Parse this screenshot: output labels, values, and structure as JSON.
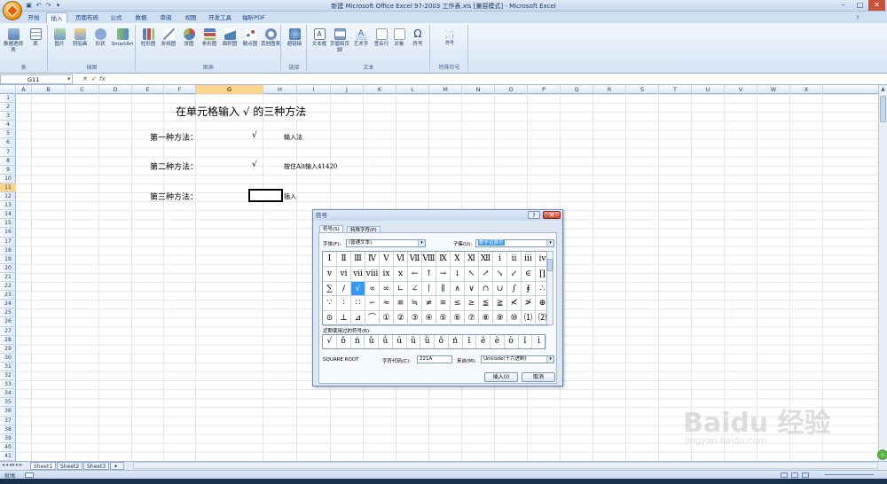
{
  "window": {
    "title": "新建 Microsoft Office Excel 97-2003 工作表.xls [兼容模式] - Microsoft Excel",
    "minimize": "–",
    "maximize": "□",
    "close": "✕"
  },
  "ribbon_tabs": [
    "开始",
    "插入",
    "页面布局",
    "公式",
    "数据",
    "审阅",
    "视图",
    "开发工具",
    "福昕PDF"
  ],
  "active_tab": "插入",
  "ribbon": {
    "groups": [
      {
        "label": "表",
        "buttons": [
          "数据透视表",
          "表"
        ]
      },
      {
        "label": "插图",
        "buttons": [
          "图片",
          "剪贴画",
          "形状",
          "SmartArt"
        ]
      },
      {
        "label": "图表",
        "buttons": [
          "柱形图",
          "折线图",
          "饼图",
          "条形图",
          "面积图",
          "散点图",
          "其他图表"
        ]
      },
      {
        "label": "链接",
        "buttons": [
          "超链接"
        ]
      },
      {
        "label": "文本",
        "buttons": [
          "文本框",
          "页眉和页脚",
          "艺术字",
          "签名行",
          "对象",
          "符号"
        ]
      },
      {
        "label": "特殊符号",
        "buttons": [
          "符号"
        ]
      }
    ]
  },
  "name_box": "G11",
  "formula_icons": [
    "✕",
    "✓",
    "fx"
  ],
  "columns": [
    "A",
    "B",
    "C",
    "D",
    "E",
    "F",
    "G",
    "H",
    "I",
    "J",
    "K",
    "L",
    "M",
    "N",
    "O",
    "P",
    "Q",
    "R",
    "S",
    "T",
    "U",
    "V",
    "W",
    "X"
  ],
  "selected_column": "G",
  "rows": [
    "1",
    "2",
    "3",
    "4",
    "5",
    "6",
    "7",
    "8",
    "9",
    "10",
    "11",
    "12",
    "13",
    "14",
    "15",
    "16",
    "17",
    "18",
    "19",
    "20",
    "21",
    "22",
    "23",
    "24",
    "25",
    "26",
    "27",
    "28",
    "29",
    "30",
    "31",
    "32",
    "33",
    "34",
    "35",
    "36",
    "37",
    "38",
    "39",
    "40",
    "41"
  ],
  "selected_row": "11",
  "cells": {
    "heading": "在单元格输入 √ 的三种方法",
    "method1_label": "第一种方法：",
    "method1_symbol": "√",
    "method1_desc": "输入法",
    "method2_label": "第二种方法：",
    "method2_symbol": "√",
    "method2_desc": "按住Alt输入41420",
    "method3_label": "第三种方法：",
    "method3_desc": "插入"
  },
  "sheet_tabs": [
    "Sheet1",
    "Sheet2",
    "Sheet3"
  ],
  "status": {
    "mode": "就绪"
  },
  "dialog": {
    "title": "符号",
    "help": "?",
    "close": "✕",
    "tabs": [
      "符号(S)",
      "特殊字符(P)"
    ],
    "font_label": "字体(F):",
    "font_value": "(普通文本)",
    "subset_label": "子集(U):",
    "subset_value": "数学运算符",
    "symbols": [
      [
        "Ⅰ",
        "Ⅱ",
        "Ⅲ",
        "Ⅳ",
        "Ⅴ",
        "Ⅵ",
        "Ⅶ",
        "Ⅷ",
        "Ⅸ",
        "Ⅹ",
        "Ⅺ",
        "Ⅻ",
        "ⅰ",
        "ⅱ",
        "ⅲ",
        "ⅳ"
      ],
      [
        "ⅴ",
        "ⅵ",
        "ⅶ",
        "ⅷ",
        "ⅸ",
        "ⅹ",
        "←",
        "↑",
        "→",
        "↓",
        "↖",
        "↗",
        "↘",
        "↙",
        "∈",
        "∏"
      ],
      [
        "∑",
        "∕",
        "√",
        "∝",
        "∞",
        "∟",
        "∠",
        "∣",
        "∥",
        "∧",
        "∨",
        "∩",
        "∪",
        "∫",
        "∮",
        "∴"
      ],
      [
        "∵",
        "∶",
        "∷",
        "∽",
        "≈",
        "≌",
        "≒",
        "≠",
        "≡",
        "≤",
        "≥",
        "≦",
        "≧",
        "≮",
        "≯",
        "⊕"
      ],
      [
        "⊙",
        "⊥",
        "⊿",
        "⌒",
        "①",
        "②",
        "③",
        "④",
        "⑤",
        "⑥",
        "⑦",
        "⑧",
        "⑨",
        "⑩",
        "⑴",
        "⑵"
      ]
    ],
    "selected_symbol": "√",
    "recent_label": "近期使用过的符号(R):",
    "recent": [
      "√",
      "ǒ",
      "ń",
      "ǔ",
      "ǘ",
      "ú",
      "ǔ",
      "ǜ",
      "ǒ",
      "ń",
      "ǐ",
      "ě",
      "è",
      "ò",
      "ǐ",
      "ì"
    ],
    "char_name": "SQUARE ROOT",
    "char_code_label": "字符代码(C):",
    "char_code": "221A",
    "from_label": "来自(M):",
    "from_value": "Unicode(十六进制)",
    "insert_button": "插入(I)",
    "cancel_button": "取消"
  },
  "watermark": {
    "brand": "Baidu 经验",
    "url": "jingyan.baidu.com"
  }
}
